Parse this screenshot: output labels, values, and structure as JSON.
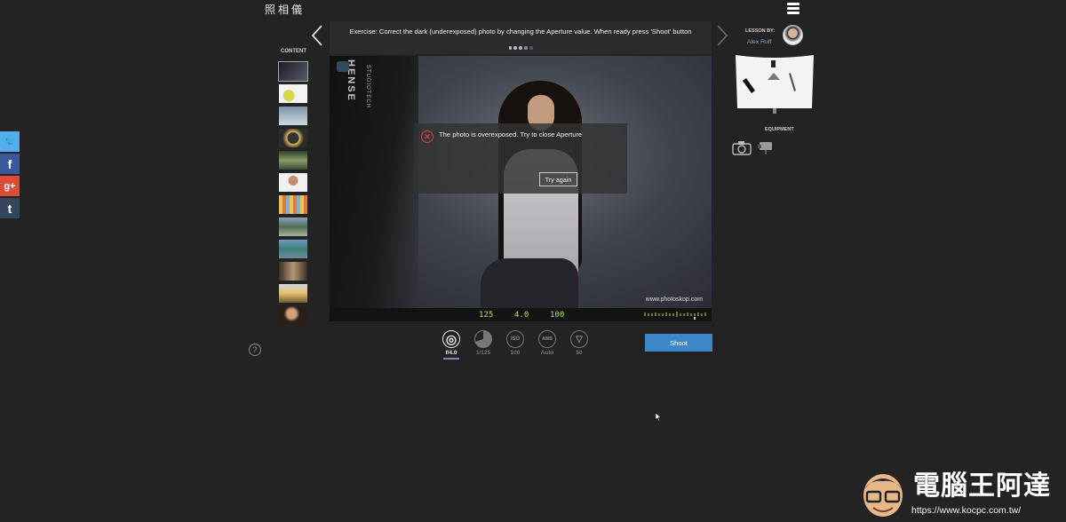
{
  "app": {
    "logo": "照相儀"
  },
  "social": {
    "twitter": "🐦",
    "facebook": "f",
    "googleplus": "g+",
    "tumblr": "t"
  },
  "help": {
    "label": "?"
  },
  "sidebar": {
    "content_label": "CONTENT"
  },
  "exercise": {
    "text": "Exercise: Correct the dark (underexposed) photo by changing the Aperture value. When ready press 'Shoot' button"
  },
  "photo": {
    "softbox_brand": "HENSE",
    "softbox_sub": "STUDIOTECH",
    "watermark": "www.photoskop.com"
  },
  "alert": {
    "icon": "close-circle-icon",
    "message": "The photo is overexposed. Try to close Aperture",
    "button": "Try again"
  },
  "readout": {
    "shutter": "125",
    "aperture": "4.0",
    "iso": "100"
  },
  "controls": [
    {
      "name": "aperture",
      "icon": "aperture-icon",
      "glyph": "◎",
      "value": "f/4.0",
      "active": true
    },
    {
      "name": "shutter",
      "icon": "shutter-icon",
      "glyph": "",
      "value": "1/125",
      "active": false
    },
    {
      "name": "iso",
      "icon": "iso-icon",
      "glyph": "ISO",
      "value": "100",
      "active": false
    },
    {
      "name": "white-balance",
      "icon": "white-balance-icon",
      "glyph": "AWB",
      "value": "Auto",
      "active": false
    },
    {
      "name": "lens",
      "icon": "lens-icon",
      "glyph": "▽",
      "value": "50",
      "active": false
    }
  ],
  "shoot": {
    "label": "Shoot"
  },
  "lesson": {
    "label": "LESSON BY:",
    "author": "Alex Ruff"
  },
  "equipment": {
    "label": "EQUIPMENT"
  },
  "brand": {
    "title": "電腦王阿達",
    "url": "https://www.kocpc.com.tw/"
  },
  "colors": {
    "accent": "#3b87c8",
    "lcd": "#b8e05a",
    "error": "#d9403a",
    "active_underline": "#7c86c9"
  }
}
